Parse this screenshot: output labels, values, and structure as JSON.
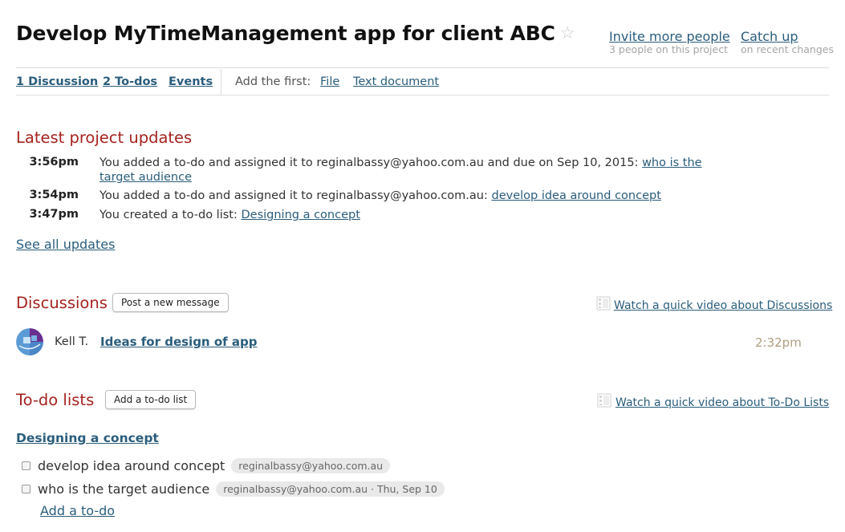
{
  "project": {
    "title": "Develop MyTimeManagement app for client ABC",
    "star_icon": "star-outline-icon"
  },
  "header": {
    "invite_label": "Invite more people",
    "invite_sub": "3 people on this project",
    "catchup_label": "Catch up",
    "catchup_sub": "on recent changes"
  },
  "nav": {
    "discussions": "1 Discussion",
    "todos": "2 To-dos",
    "events": "Events",
    "add_first_label": "Add the first:",
    "add_file": "File",
    "add_text_doc": "Text document"
  },
  "updates": {
    "heading": "Latest project updates",
    "items": [
      {
        "time": "3:56pm",
        "text": "You added a to-do and assigned it to reginalbassy@yahoo.com.au and due on Sep 10, 2015: ",
        "link": "who is the target audience"
      },
      {
        "time": "3:54pm",
        "text": "You added a to-do and assigned it to reginalbassy@yahoo.com.au: ",
        "link": "develop idea around concept"
      },
      {
        "time": "3:47pm",
        "text": "You created a to-do list: ",
        "link": "Designing a concept"
      }
    ],
    "see_all": "See all updates"
  },
  "discussions": {
    "heading": "Discussions",
    "post_button": "Post a new message",
    "video_link": "Watch a quick video about Discussions",
    "items": [
      {
        "author": "Kell T.",
        "title": "Ideas for design of app",
        "time": "2:32pm"
      }
    ]
  },
  "todo_lists": {
    "heading": "To-do lists",
    "add_button": "Add a to-do list",
    "video_link": "Watch a quick video about To-Do Lists",
    "lists": [
      {
        "title": "Designing a concept",
        "items": [
          {
            "text": "develop idea around concept",
            "assignee": "reginalbassy@yahoo.com.au",
            "done": false
          },
          {
            "text": "who is the target audience",
            "assignee": "reginalbassy@yahoo.com.au · Thu, Sep 10",
            "done": false
          }
        ],
        "add_todo": "Add a to-do"
      }
    ]
  },
  "colors": {
    "accent_red": "#a5231f",
    "link_blue": "#2a5d7c",
    "time_tan": "#b09d80"
  }
}
